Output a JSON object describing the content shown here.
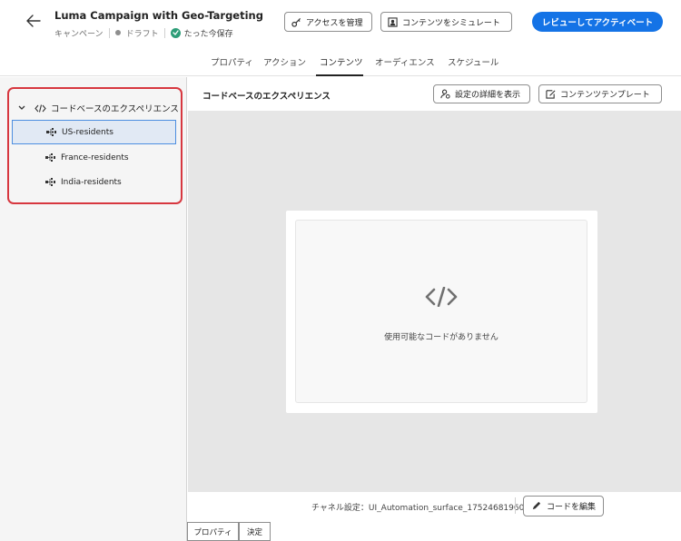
{
  "header": {
    "title": "Luma Campaign with Geo-Targeting",
    "type": "キャンペーン",
    "status": "ドラフト",
    "saved": "たった今保存",
    "manage_access": "アクセスを管理",
    "simulate_content": "コンテンツをシミュレート",
    "review_activate": "レビューしてアクティベート"
  },
  "tabs": [
    {
      "label": "プロパティ"
    },
    {
      "label": "アクション"
    },
    {
      "label": "コンテンツ"
    },
    {
      "label": "オーディエンス"
    },
    {
      "label": "スケジュール"
    }
  ],
  "active_tab": "コンテンツ",
  "tree": {
    "root_label": "コードベースのエクスペリエンス",
    "items": [
      {
        "label": "US-residents",
        "selected": true
      },
      {
        "label": "France-residents",
        "selected": false
      },
      {
        "label": "India-residents",
        "selected": false
      }
    ]
  },
  "content_header": {
    "title": "コードベースのエクスペリエンス",
    "settings_details": "設定の詳細を表示",
    "content_template": "コンテンツテンプレート"
  },
  "empty_state": {
    "message": "使用可能なコードがありません"
  },
  "footer": {
    "channel_label": "チャネル設定：",
    "channel_value": "UI_Automation_surface_1752468196069",
    "edit_code": "コードを編集"
  },
  "bottom_tabs": [
    "プロパティ",
    "決定"
  ],
  "colors": {
    "accent": "#1473e6",
    "highlight_border": "#d7373f",
    "selected_bg": "#e1e9f4",
    "saved_check": "#2d9d78"
  }
}
